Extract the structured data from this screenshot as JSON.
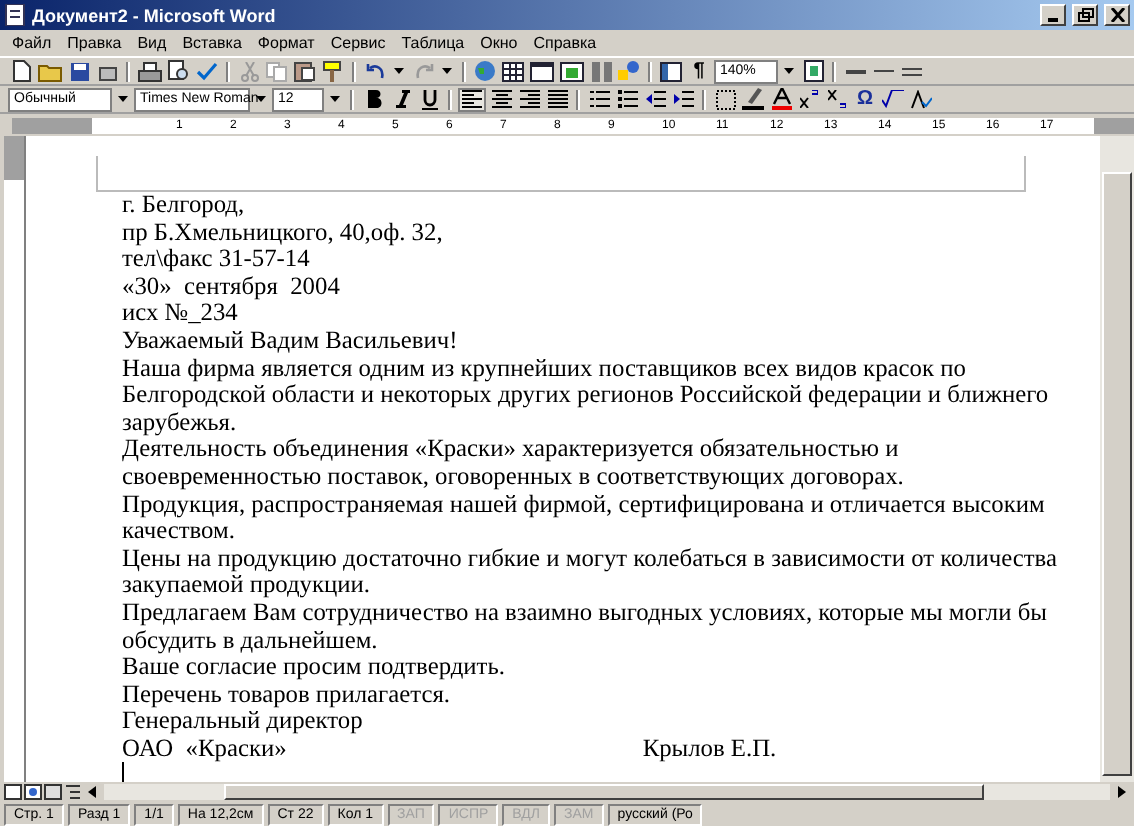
{
  "window": {
    "title": "Документ2 - Microsoft Word"
  },
  "menu": [
    "Файл",
    "Правка",
    "Вид",
    "Вставка",
    "Формат",
    "Сервис",
    "Таблица",
    "Окно",
    "Справка"
  ],
  "toolbar": {
    "formatting_marks": "¶",
    "zoom": "140%",
    "symbol": "Ω"
  },
  "formatting": {
    "style": "Обычный",
    "font": "Times New Roman",
    "size": "12"
  },
  "ruler": {
    "marks": [
      "1",
      "2",
      "3",
      "4",
      "5",
      "6",
      "7",
      "8",
      "9",
      "10",
      "11",
      "12",
      "13",
      "14",
      "15",
      "16",
      "17"
    ]
  },
  "document": {
    "lines": [
      {
        "text": "г. Белгород,"
      },
      {
        "text": "пр Б.Хмельницкого, 40,оф. 32,"
      },
      {
        "text": "тел\\факс 31-57-14"
      },
      {
        "text": "«30»  сентября  2004"
      },
      {
        "text": "исх №_234"
      },
      {
        "text": "Уважаемый Вадим Васильевич!"
      },
      {
        "text": "Наша фирма является одним из крупнейших поставщиков всех видов красок по"
      },
      {
        "text": "Белгородской области и некоторых других регионов Российской федерации и ближнего"
      },
      {
        "text": "зарубежья."
      },
      {
        "text": "Деятельность объединения «Краски» характеризуется обязательностью и"
      },
      {
        "text": "своевременностью поставок, оговоренных в соответствующих договорах."
      },
      {
        "text": "Продукция, распространяемая нашей фирмой, сертифицирована и отличается высоким"
      },
      {
        "text": "качеством."
      },
      {
        "text": "Цены на продукцию достаточно гибкие и могут колебаться в зависимости от количества"
      },
      {
        "text": "закупаемой продукции."
      },
      {
        "text": "Предлагаем Вам сотрудничество на взаимно выгодных условиях, которые мы могли бы"
      },
      {
        "text": "обсудить в дальнейшем."
      },
      {
        "text": "Ваше согласие просим подтвердить."
      },
      {
        "text": "Перечень товаров прилагается."
      },
      {
        "text": "Генеральный директор"
      },
      {
        "text": "ОАО  «Краски»",
        "signature": "Крылов Е.П."
      }
    ]
  },
  "status_bar": {
    "fields": [
      {
        "text": "Стр. 1",
        "on": true
      },
      {
        "text": "Разд 1",
        "on": true
      },
      {
        "text": "1/1",
        "on": true
      },
      {
        "text": "На 12,2см",
        "on": true
      },
      {
        "text": "Ст 22",
        "on": true
      },
      {
        "text": "Кол 1",
        "on": true
      },
      {
        "text": "ЗАП",
        "on": false
      },
      {
        "text": "ИСПР",
        "on": false
      },
      {
        "text": "ВДЛ",
        "on": false
      },
      {
        "text": "ЗАМ",
        "on": false
      },
      {
        "text": "русский (Ро",
        "on": true
      }
    ]
  }
}
